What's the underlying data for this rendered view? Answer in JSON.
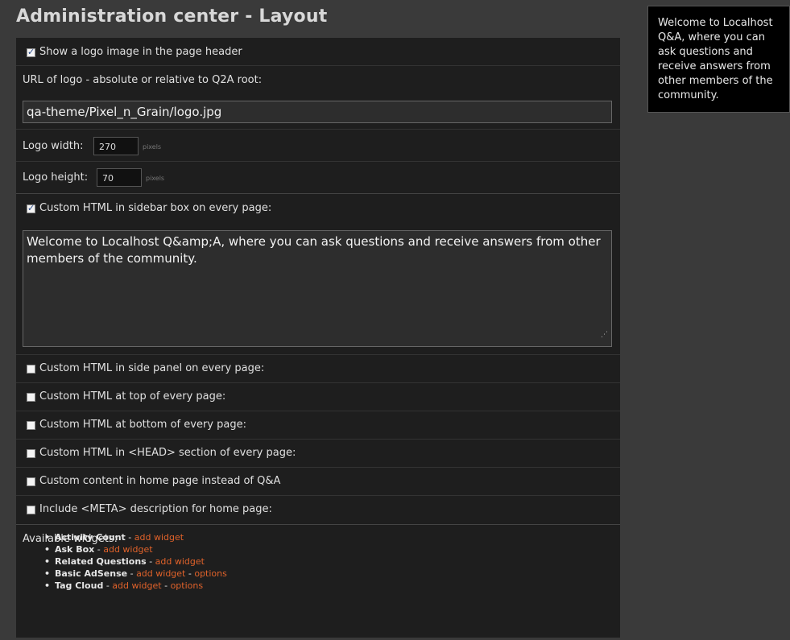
{
  "page": {
    "title": "Administration center - Layout"
  },
  "options": {
    "show_logo": {
      "label": "Show a logo image in the page header",
      "checked": true
    },
    "logo_url": {
      "label": "URL of logo - absolute or relative to Q2A root:",
      "value": "qa-theme/Pixel_n_Grain/logo.jpg"
    },
    "logo_width": {
      "label": "Logo width:",
      "value": "270",
      "unit": "pixels"
    },
    "logo_height": {
      "label": "Logo height:",
      "value": "70",
      "unit": "pixels"
    },
    "sidebar_html": {
      "label": "Custom HTML in sidebar box on every page:",
      "checked": true,
      "value": "Welcome to Localhost Q&amp;A, where you can ask questions and receive answers from other members of the community."
    },
    "side_panel_html": {
      "label": "Custom HTML in side panel on every page:",
      "checked": false
    },
    "top_html": {
      "label": "Custom HTML at top of every page:",
      "checked": false
    },
    "bottom_html": {
      "label": "Custom HTML at bottom of every page:",
      "checked": false
    },
    "head_html": {
      "label": "Custom HTML in <HEAD> section of every page:",
      "checked": false
    },
    "home_content": {
      "label": "Custom content in home page instead of Q&A",
      "checked": false
    },
    "meta_description": {
      "label": "Include <META> description for home page:",
      "checked": false
    }
  },
  "widgets": {
    "heading": "Available widgets:",
    "separator": " - ",
    "items": [
      {
        "name": "Activity Count",
        "add_label": "add widget"
      },
      {
        "name": "Ask Box",
        "add_label": "add widget"
      },
      {
        "name": "Related Questions",
        "add_label": "add widget"
      },
      {
        "name": "Basic AdSense",
        "add_label": "add widget",
        "options_label": "options"
      },
      {
        "name": "Tag Cloud",
        "add_label": "add widget",
        "options_label": "options"
      }
    ]
  },
  "sidebar_box": {
    "text": "Welcome to Localhost Q&A, where you can ask questions and receive answers from other members of the community."
  }
}
